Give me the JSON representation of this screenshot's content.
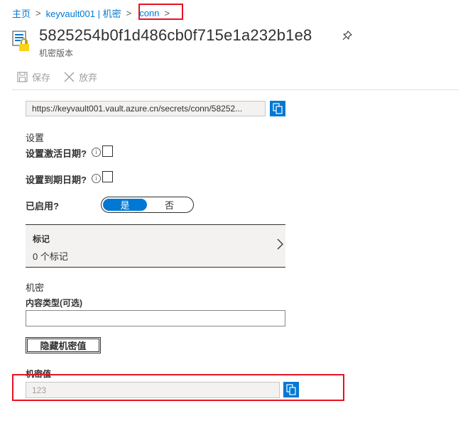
{
  "breadcrumb": {
    "home": "主页",
    "vault": "keyvault001 | 机密",
    "secret": "conn",
    "separator": ">"
  },
  "header": {
    "title": "5825254b0f1d486cb0f715e1a232b1e8",
    "subtitle": "机密版本"
  },
  "toolbar": {
    "save_label": "保存",
    "discard_label": "放弃"
  },
  "identifier_url": "https://keyvault001.vault.azure.cn/secrets/conn/58252...",
  "settings": {
    "section_title": "设置",
    "activation_label": "设置激活日期?",
    "expiration_label": "设置到期日期?",
    "enabled_label": "已启用?",
    "toggle_yes": "是",
    "toggle_no": "否",
    "info_glyph": "i"
  },
  "tags": {
    "title": "标记",
    "count_text": "0 个标记"
  },
  "secret": {
    "section_title": "机密",
    "content_type_label": "内容类型(可选)",
    "content_type_value": "",
    "hide_button_label": "隐藏机密值",
    "value_label": "机密值",
    "value": "123"
  },
  "colors": {
    "accent": "#0078d4",
    "highlight_border": "#e81123"
  }
}
